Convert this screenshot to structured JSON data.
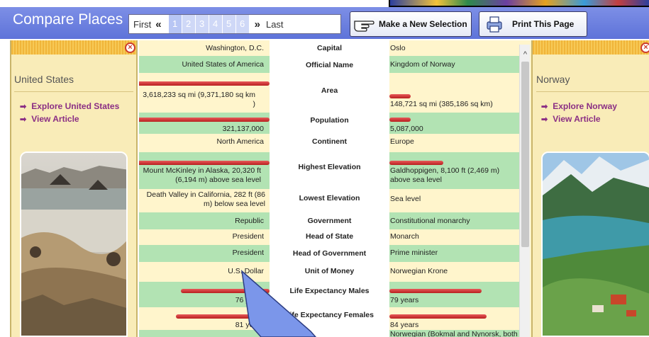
{
  "app": {
    "title": "Compare Places"
  },
  "pager": {
    "first": "First",
    "last": "Last",
    "prev": "«",
    "next": "»",
    "pages": [
      "1",
      "2",
      "3",
      "4",
      "5",
      "6"
    ],
    "current": "1"
  },
  "toolbar": {
    "new_selection": "Make a New Selection",
    "print": "Print This Page"
  },
  "left": {
    "country": "United States",
    "explore": "Explore United States",
    "article": "View Article"
  },
  "right": {
    "country": "Norway",
    "explore": "Explore Norway",
    "article": "View Article"
  },
  "rows": [
    {
      "label": "Capital",
      "left": "Washington, D.C.",
      "right": "Oslo"
    },
    {
      "label": "Official Name",
      "left": "United States of America",
      "right": "Kingdom of Norway"
    },
    {
      "label": "Area",
      "left": "3,618,233 sq mi (9,371,180 sq km )",
      "right": "148,721 sq mi (385,186 sq km)"
    },
    {
      "label": "Population",
      "left": "321,137,000",
      "right": "5,087,000"
    },
    {
      "label": "Continent",
      "left": "North America",
      "right": "Europe"
    },
    {
      "label": "Highest Elevation",
      "left": "Mount McKinley in Alaska, 20,320 ft (6,194 m) above sea level",
      "right": "Galdhoppigen, 8,100 ft (2,469 m) above sea level"
    },
    {
      "label": "Lowest Elevation",
      "left": "Death Valley in California, 282 ft (86 m) below sea level",
      "right": "Sea level"
    },
    {
      "label": "Government",
      "left": "Republic",
      "right": "Constitutional monarchy"
    },
    {
      "label": "Head of State",
      "left": "President",
      "right": "Monarch"
    },
    {
      "label": "Head of Government",
      "left": "President",
      "right": "Prime minister"
    },
    {
      "label": "Unit of Money",
      "left": "U.S. Dollar",
      "right": "Norwegian Krone"
    },
    {
      "label": "Life Expectancy Males",
      "left": "76 years",
      "right": "79 years"
    },
    {
      "label": "Life Expectancy Females",
      "left": "81 years",
      "right": "84 years"
    },
    {
      "label": "",
      "left": "",
      "right": "Norwegian (Bokmal and Nynorsk, both"
    }
  ]
}
